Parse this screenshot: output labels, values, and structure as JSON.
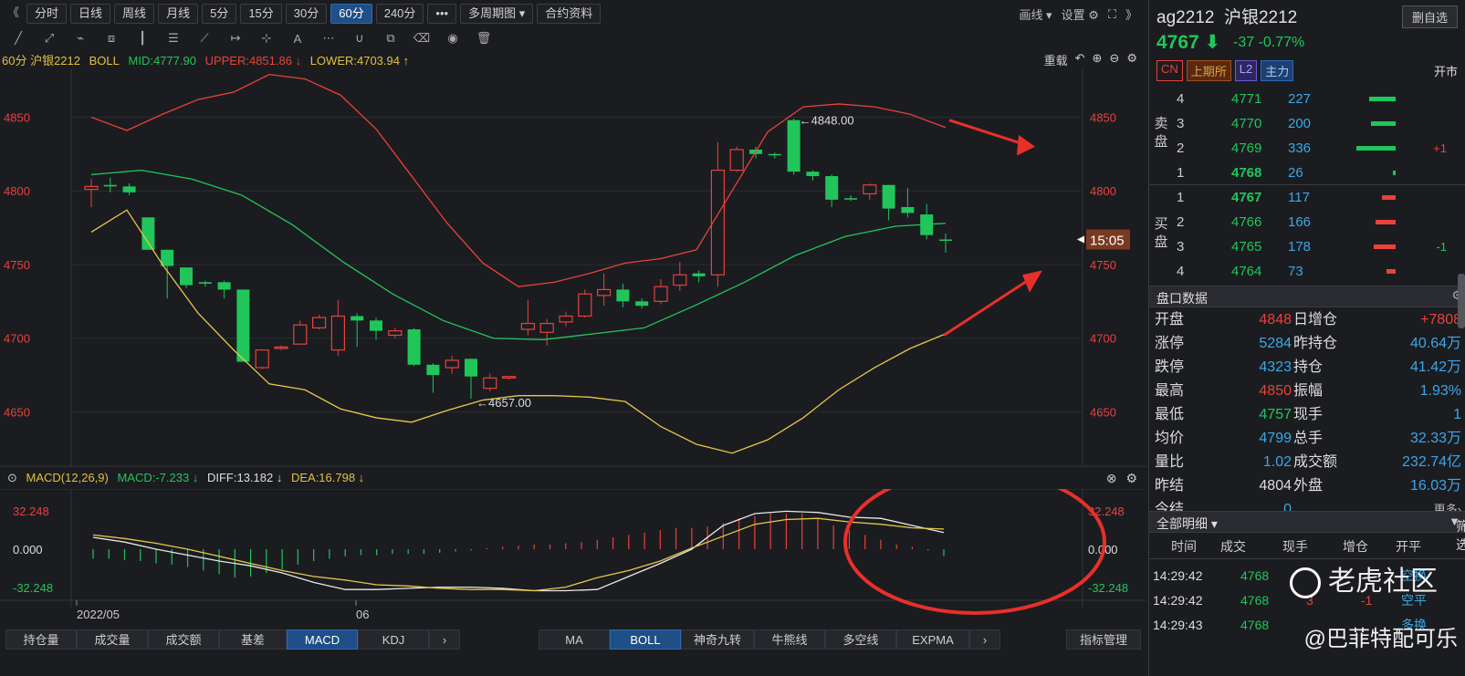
{
  "toolbar": {
    "collapse_label": "《",
    "periods": [
      "分时",
      "日线",
      "周线",
      "月线",
      "5分",
      "15分",
      "30分",
      "60分",
      "240分"
    ],
    "active_period": "60分",
    "more_label": "•••",
    "multi_period_label": "多周期图 ▾",
    "contract_info_label": "合约资料",
    "draw_label": "画线 ▾",
    "settings_label": "设置",
    "expand_label": "》"
  },
  "legend": {
    "prefix": "60分 沪银2212",
    "indicator": "BOLL",
    "mid": "MID:4777.90",
    "upper": "UPPER:4851.86 ↓",
    "lower": "LOWER:4703.94 ↑",
    "reload_label": "重载"
  },
  "macd_legend": {
    "name": "MACD(12,26,9)",
    "macd": "MACD:-7.233 ↓",
    "diff": "DIFF:13.182 ↓",
    "dea": "DEA:16.798 ↓"
  },
  "main_chart": {
    "ymin": 4615,
    "ymax": 4880,
    "ticks": [
      4850,
      4800,
      4750,
      4700,
      4650
    ],
    "tick_labels": [
      "4850",
      "4800",
      "4750",
      "4700",
      "4650"
    ],
    "high_label": "←4848.00",
    "low_label": "←4657.00",
    "price_tag": "15:05",
    "candles": [
      [
        4801,
        4803,
        4789,
        4808,
        "up"
      ],
      [
        4804,
        4803,
        4799,
        4809,
        "down"
      ],
      [
        4803,
        4799,
        4797,
        4805,
        "down"
      ],
      [
        4782,
        4760,
        4760,
        4782,
        "down"
      ],
      [
        4760,
        4749,
        4727,
        4760,
        "down"
      ],
      [
        4748,
        4736,
        4734,
        4748,
        "down"
      ],
      [
        4738,
        4737,
        4735,
        4739,
        "down"
      ],
      [
        4738,
        4733,
        4727,
        4739,
        "down"
      ],
      [
        4733,
        4684,
        4684,
        4733,
        "down"
      ],
      [
        4680,
        4692,
        4679,
        4692,
        "up"
      ],
      [
        4693,
        4694,
        4692,
        4695,
        "up"
      ],
      [
        4696,
        4709,
        4696,
        4712,
        "up"
      ],
      [
        4707,
        4714,
        4706,
        4716,
        "up"
      ],
      [
        4692,
        4715,
        4688,
        4726,
        "up"
      ],
      [
        4715,
        4712,
        4694,
        4717,
        "down"
      ],
      [
        4712,
        4705,
        4699,
        4714,
        "down"
      ],
      [
        4702,
        4705,
        4700,
        4707,
        "up"
      ],
      [
        4706,
        4682,
        4681,
        4707,
        "down"
      ],
      [
        4682,
        4675,
        4663,
        4683,
        "down"
      ],
      [
        4680,
        4685,
        4676,
        4688,
        "up"
      ],
      [
        4686,
        4674,
        4659,
        4686,
        "down"
      ],
      [
        4666,
        4673,
        4664,
        4676,
        "up"
      ],
      [
        4673,
        4674,
        4672,
        4674,
        "up"
      ],
      [
        4706,
        4710,
        4702,
        4726,
        "up"
      ],
      [
        4704,
        4710,
        4695,
        4713,
        "up"
      ],
      [
        4711,
        4715,
        4708,
        4718,
        "up"
      ],
      [
        4715,
        4730,
        4714,
        4733,
        "up"
      ],
      [
        4729,
        4733,
        4722,
        4744,
        "up"
      ],
      [
        4733,
        4725,
        4721,
        4737,
        "down"
      ],
      [
        4722,
        4725,
        4720,
        4727,
        "down"
      ],
      [
        4725,
        4735,
        4723,
        4740,
        "up"
      ],
      [
        4736,
        4743,
        4732,
        4752,
        "up"
      ],
      [
        4742,
        4744,
        4738,
        4746,
        "down"
      ],
      [
        4743,
        4814,
        4735,
        4833,
        "up"
      ],
      [
        4814,
        4828,
        4813,
        4830,
        "up"
      ],
      [
        4828,
        4825,
        4822,
        4830,
        "down"
      ],
      [
        4825,
        4825,
        4822,
        4826,
        "down"
      ],
      [
        4848,
        4813,
        4811,
        4849,
        "down"
      ],
      [
        4813,
        4810,
        4807,
        4814,
        "down"
      ],
      [
        4810,
        4794,
        4789,
        4811,
        "down"
      ],
      [
        4795,
        4795,
        4793,
        4797,
        "down"
      ],
      [
        4798,
        4804,
        4794,
        4805,
        "up"
      ],
      [
        4804,
        4788,
        4780,
        4804,
        "down"
      ],
      [
        4789,
        4785,
        4782,
        4802,
        "down"
      ],
      [
        4784,
        4770,
        4767,
        4791,
        "down"
      ],
      [
        4767,
        4767,
        4758,
        4771,
        "down"
      ]
    ],
    "upper": [
      4850,
      4841,
      4852,
      4862,
      4867,
      4879,
      4876,
      4865,
      4842,
      4810,
      4778,
      4751,
      4735,
      4738,
      4744,
      4751,
      4754,
      4760,
      4800,
      4840,
      4857,
      4859,
      4857,
      4852,
      4843
    ],
    "mid": [
      4811,
      4814,
      4808,
      4797,
      4777,
      4752,
      4730,
      4712,
      4700,
      4699,
      4703,
      4707,
      4722,
      4738,
      4756,
      4769,
      4776,
      4778
    ],
    "lower": [
      4772,
      4787,
      4750,
      4717,
      4692,
      4669,
      4665,
      4652,
      4646,
      4643,
      4651,
      4658,
      4661,
      4661,
      4660,
      4657,
      4640,
      4628,
      4622,
      4631,
      4646,
      4665,
      4680,
      4693,
      4703
    ]
  },
  "macd_chart": {
    "ymin": -40,
    "ymax": 40,
    "tick_labels": [
      "32.248",
      "0.000",
      "-32.248"
    ],
    "date_labels": [
      "2022/05",
      "06"
    ],
    "diff": [
      10,
      6,
      0,
      -5,
      -10,
      -14,
      -20,
      -28,
      -34,
      -34,
      -33,
      -32,
      -32,
      -33,
      -35,
      -35,
      -34,
      -23,
      -12,
      0,
      20,
      30,
      32,
      31,
      27,
      26,
      20,
      14
    ],
    "dea": [
      12,
      9,
      5,
      0,
      -6,
      -12,
      -18,
      -23,
      -26,
      -30,
      -31,
      -33,
      -34,
      -34,
      -35,
      -32,
      -24,
      -18,
      -10,
      1,
      11,
      21,
      25,
      26,
      23,
      21,
      18,
      17
    ],
    "hist": [
      -8,
      -8,
      -9,
      -10,
      -12,
      -13,
      -15,
      -18,
      -21,
      -24,
      -23,
      -20,
      -17,
      -13,
      -10,
      -8,
      -6,
      -5,
      -5,
      -4,
      -4,
      -4,
      -3,
      -2,
      -1,
      1,
      2,
      3,
      4,
      4,
      5,
      6,
      8,
      10,
      12,
      14,
      16,
      18,
      18,
      19,
      22,
      26,
      28,
      30,
      30,
      30,
      26,
      20,
      16,
      12,
      8,
      4,
      2,
      -1,
      -6
    ],
    "macd_value": -7.233
  },
  "bottom_tabs_left": [
    "持仓量",
    "成交量",
    "成交额",
    "基差",
    "MACD",
    "KDJ",
    "›"
  ],
  "bottom_tabs_right": [
    "MA",
    "BOLL",
    "神奇九转",
    "牛熊线",
    "多空线",
    "EXPMA",
    "›"
  ],
  "indicator_mgmt": "指标管理",
  "active_bottom_left": "MACD",
  "active_bottom_right": "BOLL",
  "quote": {
    "code": "ag2212",
    "name": "沪银2212",
    "unfav_label": "删自选",
    "price": "4767 ⬇",
    "change": "-37  -0.77%",
    "tags": [
      "CN",
      "上期所",
      "L2",
      "主力"
    ],
    "status": "开市"
  },
  "orderbook": {
    "sell_label": "卖盘",
    "buy_label": "买盘",
    "sell": [
      {
        "lv": "4",
        "price": "4771",
        "vol": "227",
        "bar": 0.42,
        "chg": ""
      },
      {
        "lv": "3",
        "price": "4770",
        "vol": "200",
        "bar": 0.38,
        "chg": ""
      },
      {
        "lv": "2",
        "price": "4769",
        "vol": "336",
        "bar": 0.62,
        "chg": "+1"
      },
      {
        "lv": "1",
        "price": "4768",
        "vol": "26",
        "bar": 0.04,
        "chg": ""
      }
    ],
    "buy": [
      {
        "lv": "1",
        "price": "4767",
        "vol": "117",
        "bar": 0.22,
        "chg": ""
      },
      {
        "lv": "2",
        "price": "4766",
        "vol": "166",
        "bar": 0.32,
        "chg": ""
      },
      {
        "lv": "3",
        "price": "4765",
        "vol": "178",
        "bar": 0.34,
        "chg": "-1"
      },
      {
        "lv": "4",
        "price": "4764",
        "vol": "73",
        "bar": 0.14,
        "chg": ""
      }
    ]
  },
  "pankou": {
    "title": "盘口数据",
    "rows": [
      {
        "k1": "开盘",
        "v1": "4848",
        "c1": "#e8423a",
        "k2": "日增仓",
        "v2": "+7808",
        "c2": "#e8423a"
      },
      {
        "k1": "涨停",
        "v1": "5284",
        "c1": "#3aa7e8",
        "k2": "昨持仓",
        "v2": "40.64万",
        "c2": "#3aa7e8"
      },
      {
        "k1": "跌停",
        "v1": "4323",
        "c1": "#3aa7e8",
        "k2": "持仓",
        "v2": "41.42万",
        "c2": "#3aa7e8"
      },
      {
        "k1": "最高",
        "v1": "4850",
        "c1": "#e8423a",
        "k2": "振幅",
        "v2": "1.93%",
        "c2": "#3aa7e8"
      },
      {
        "k1": "最低",
        "v1": "4757",
        "c1": "#20c65a",
        "k2": "现手",
        "v2": "1",
        "c2": "#3aa7e8"
      },
      {
        "k1": "均价",
        "v1": "4799",
        "c1": "#3aa7e8",
        "k2": "总手",
        "v2": "32.33万",
        "c2": "#3aa7e8"
      },
      {
        "k1": "量比",
        "v1": "1.02",
        "c1": "#3aa7e8",
        "k2": "成交额",
        "v2": "232.74亿",
        "c2": "#3aa7e8"
      },
      {
        "k1": "昨结",
        "v1": "4804",
        "c1": "#dddddd",
        "k2": "外盘",
        "v2": "16.03万",
        "c2": "#3aa7e8"
      },
      {
        "k1": "今结",
        "v1": "0",
        "c1": "#3aa7e8",
        "k2": "",
        "v2": "更多›",
        "c2": "#bbbbbb"
      }
    ]
  },
  "detail": {
    "title": "全部明细 ▾",
    "filter": "筛选",
    "cols": [
      "时间",
      "成交",
      "现手",
      "增仓",
      "开平"
    ],
    "rows": [
      {
        "t": "14:29:42",
        "p": "4768",
        "q": "",
        "z": "",
        "kp": "空换"
      },
      {
        "t": "14:29:42",
        "p": "4768",
        "q": "3",
        "z": "-1",
        "kp": "空平"
      },
      {
        "t": "14:29:43",
        "p": "4768",
        "q": "",
        "z": "",
        "kp": "多换"
      }
    ]
  },
  "watermark": {
    "brand": "老虎社区",
    "author": "@巴菲特配可乐"
  }
}
